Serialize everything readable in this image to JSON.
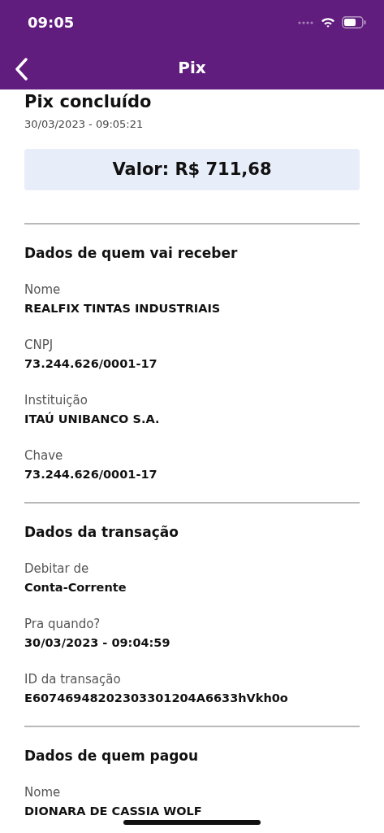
{
  "status_bar": {
    "time": "09:05"
  },
  "header": {
    "title": "Pix"
  },
  "receipt": {
    "title": "Pix concluído",
    "datetime": "30/03/2023 - 09:05:21",
    "amount": "Valor: R$ 711,68"
  },
  "sections": [
    {
      "heading": "Dados de quem vai receber",
      "fields": [
        {
          "label": "Nome",
          "value": "REALFIX TINTAS INDUSTRIAIS"
        },
        {
          "label": "CNPJ",
          "value": "73.244.626/0001-17"
        },
        {
          "label": "Instituição",
          "value": "ITAÚ UNIBANCO S.A."
        },
        {
          "label": "Chave",
          "value": "73.244.626/0001-17"
        }
      ]
    },
    {
      "heading": "Dados da transação",
      "fields": [
        {
          "label": "Debitar de",
          "value": "Conta-Corrente"
        },
        {
          "label": "Pra quando?",
          "value": "30/03/2023 - 09:04:59"
        },
        {
          "label": "ID da transação",
          "value": "E60746948202303301204A6633hVkh0o"
        }
      ]
    },
    {
      "heading": "Dados de quem pagou",
      "fields": [
        {
          "label": "Nome",
          "value": "DIONARA DE CASSIA WOLF"
        }
      ]
    }
  ]
}
